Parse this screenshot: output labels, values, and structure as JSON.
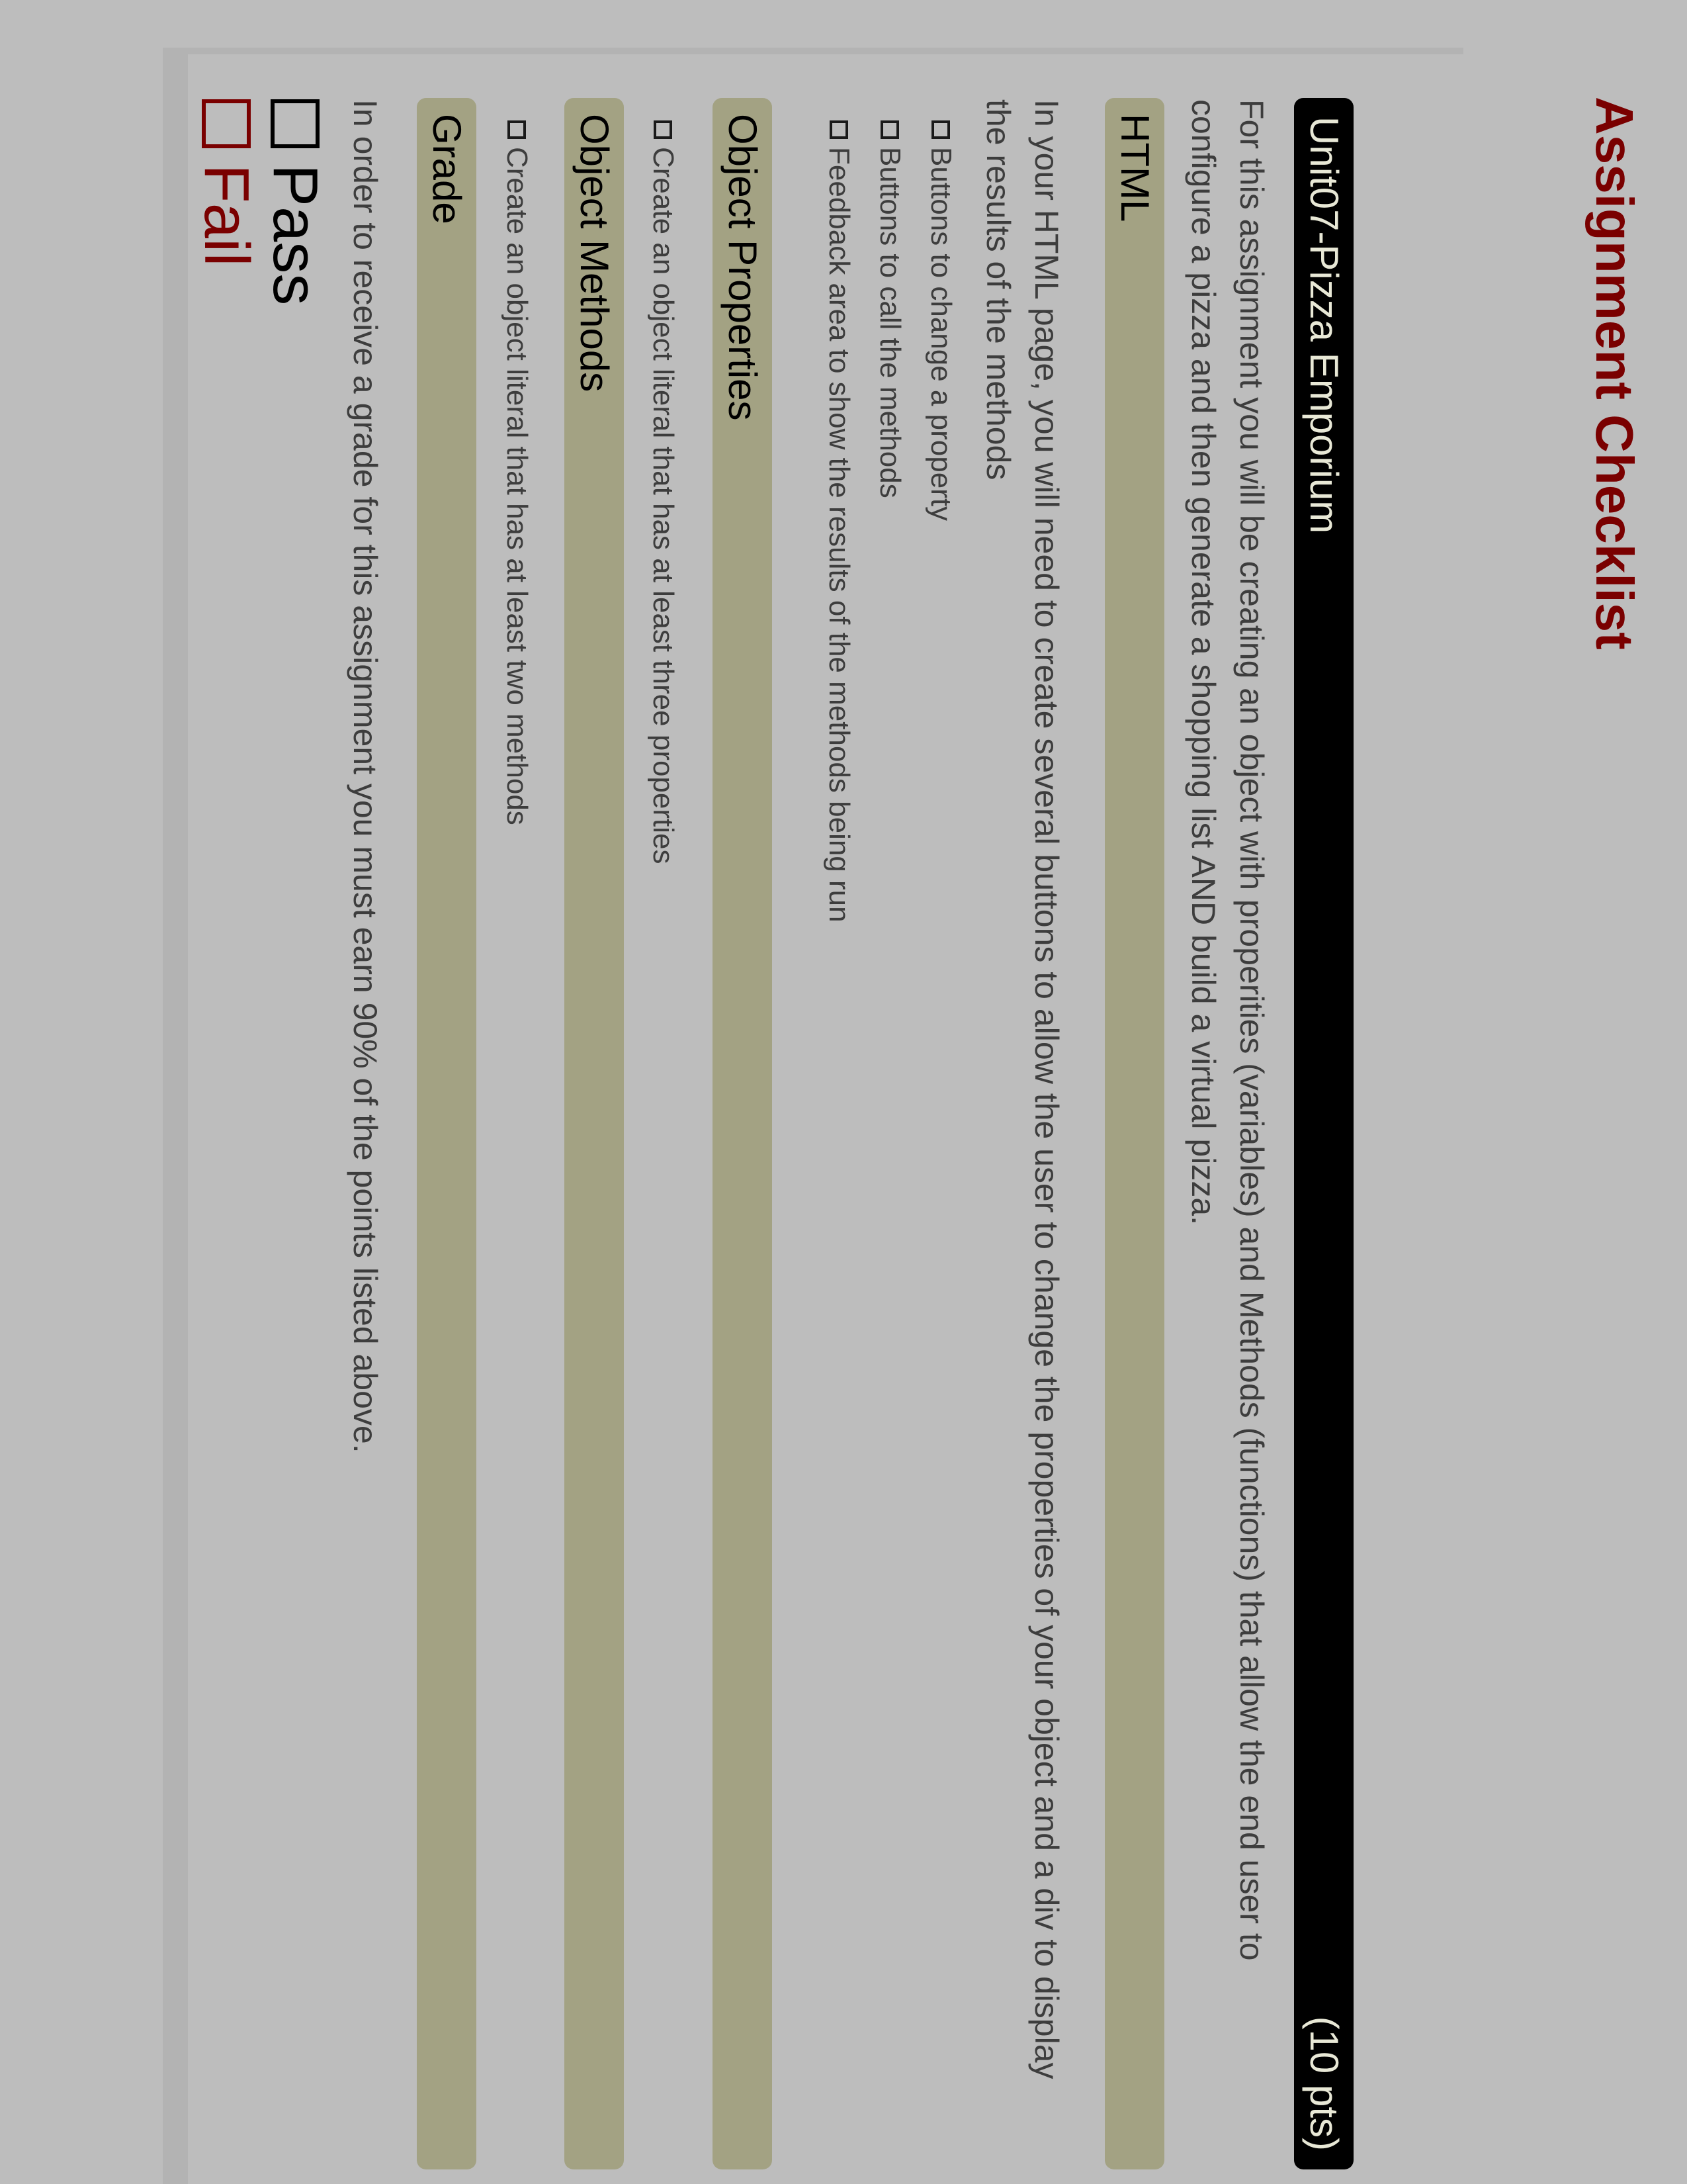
{
  "title": "Assignment Checklist",
  "assignment": {
    "name": "Unit07-Pizza Emporium",
    "points": "(10 pts)",
    "description": "For this assignment you will be creating an object with properities (variables) and Methods (functions) that allow the end user to configure a pizza and then generate a shopping list AND build a virtual pizza."
  },
  "sections": [
    {
      "heading": "HTML",
      "description": "In your HTML page, you will need to create several buttons to allow the user to change the properties of your object and a div to display the results of the methods",
      "items": [
        "Buttons to change a property",
        "Buttons to call the methods",
        "Feedback area to show the results of the methods being run"
      ]
    },
    {
      "heading": "Object Properties",
      "items": [
        "Create an object literal that has at least three properties"
      ]
    },
    {
      "heading": "Object Methods",
      "items": [
        "Create an object literal that has at least two methods"
      ]
    },
    {
      "heading": "Grade",
      "description": "In order to receive a grade for this assignment you must earn 90% of the points listed above."
    }
  ],
  "grade_options": {
    "pass": "Pass",
    "fail": "Fail"
  },
  "colors": {
    "title": "#7a0000",
    "header_bar": "#000000",
    "header_text": "#e8e8d6",
    "section_bar": "#a3a283",
    "body_text": "#3d3d3d",
    "pass": "#000000",
    "fail": "#7a0000",
    "background": "#bdbdbd"
  }
}
